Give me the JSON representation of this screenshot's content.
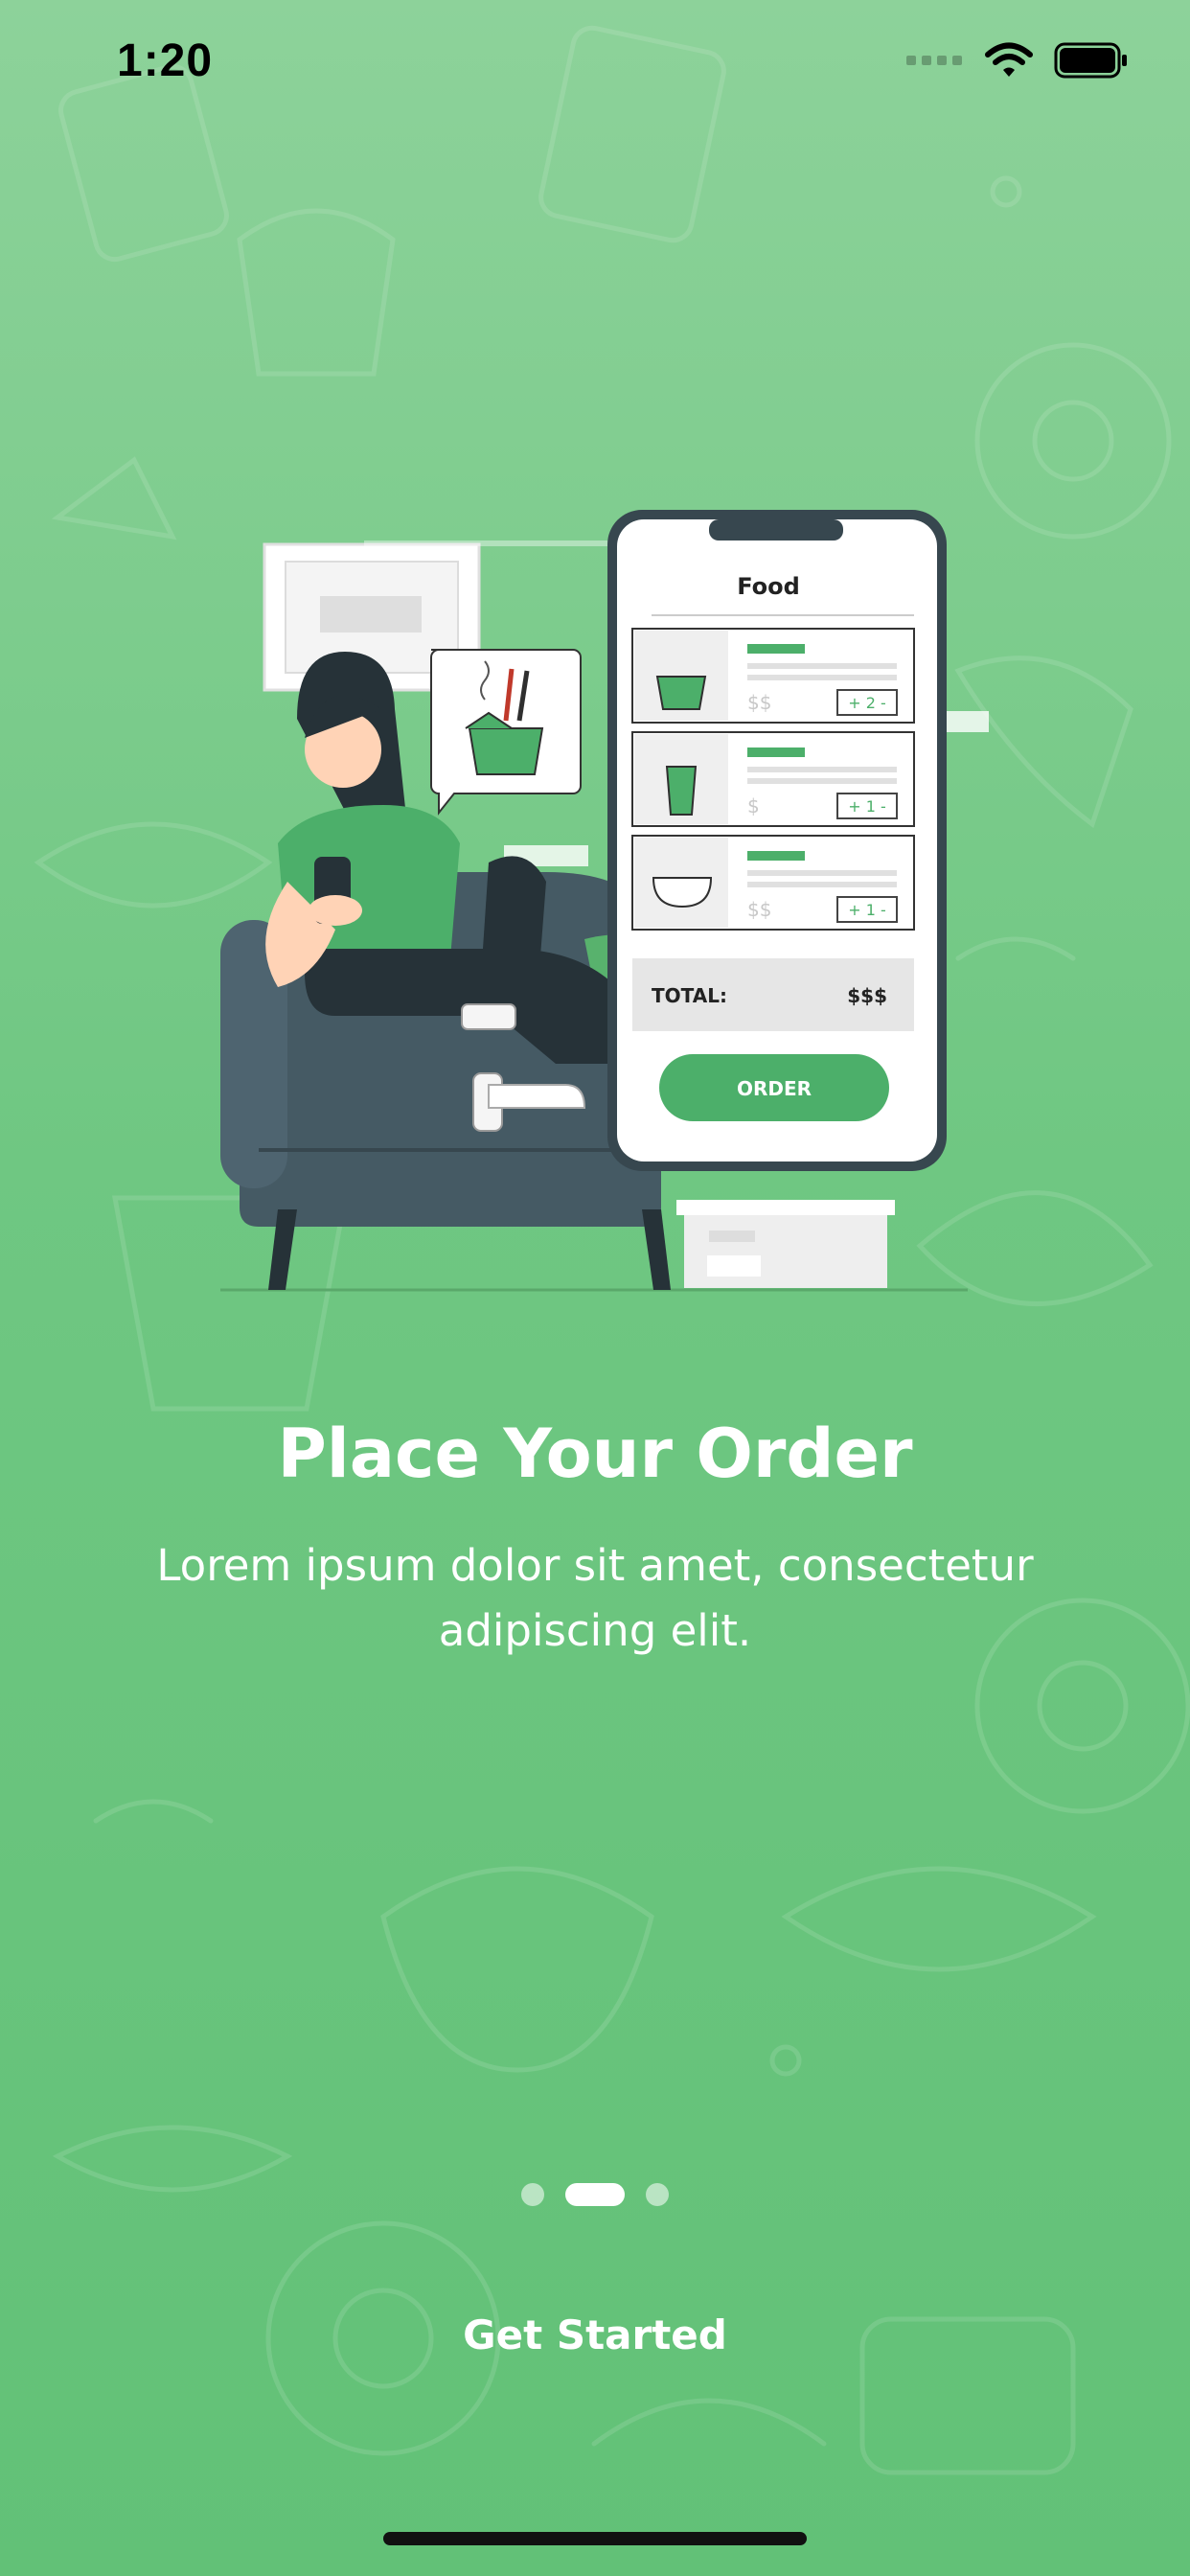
{
  "status_bar": {
    "time": "1:20",
    "icons": [
      "signal-icon",
      "wifi-icon",
      "battery-icon"
    ]
  },
  "illustration": {
    "phone_header": "Food",
    "items": [
      {
        "icon": "takeout-box-icon",
        "price": "$$",
        "qty": "+ 2 -"
      },
      {
        "icon": "drink-cup-icon",
        "price": "$",
        "qty": "+ 1 -"
      },
      {
        "icon": "salad-bowl-icon",
        "price": "$$",
        "qty": "+ 1 -"
      }
    ],
    "total_label": "TOTAL:",
    "total_value": "$$$",
    "order_button": "ORDER"
  },
  "onboarding": {
    "title": "Place Your Order",
    "subtitle": "Lorem ipsum dolor sit amet, consectetur adipiscing elit.",
    "page_indicator": {
      "total": 3,
      "current": 2
    },
    "cta_label": "Get Started"
  },
  "colors": {
    "background_top": "#8dd29a",
    "background_bottom": "#62c177",
    "accent": "#4caf6a",
    "text": "#ffffff"
  }
}
